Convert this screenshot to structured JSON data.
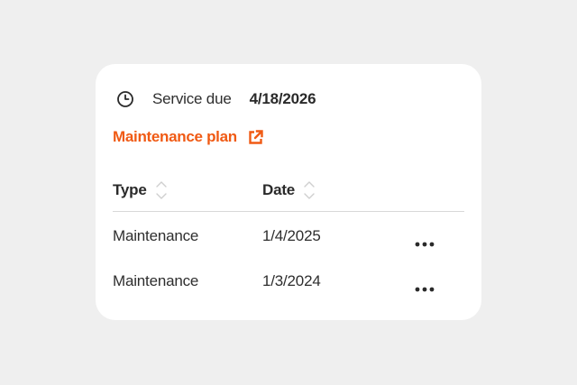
{
  "service": {
    "icon": "clock-icon",
    "label": "Service due",
    "date": "4/18/2026"
  },
  "maintenance_plan": {
    "label": "Maintenance plan",
    "icon": "external-link-icon",
    "color": "#f05a14"
  },
  "table": {
    "columns": [
      {
        "label": "Type",
        "sort_icon": "sort-icon"
      },
      {
        "label": "Date",
        "sort_icon": "sort-icon"
      }
    ],
    "rows": [
      {
        "type": "Maintenance",
        "date": "1/4/2025",
        "action_icon": "more-horizontal-icon"
      },
      {
        "type": "Maintenance",
        "date": "1/3/2024",
        "action_icon": "more-horizontal-icon"
      }
    ]
  },
  "colors": {
    "background": "#efefef",
    "card": "#ffffff",
    "accent": "#f05a14",
    "divider": "#d8d8d8",
    "text": "#2a2a2a"
  }
}
